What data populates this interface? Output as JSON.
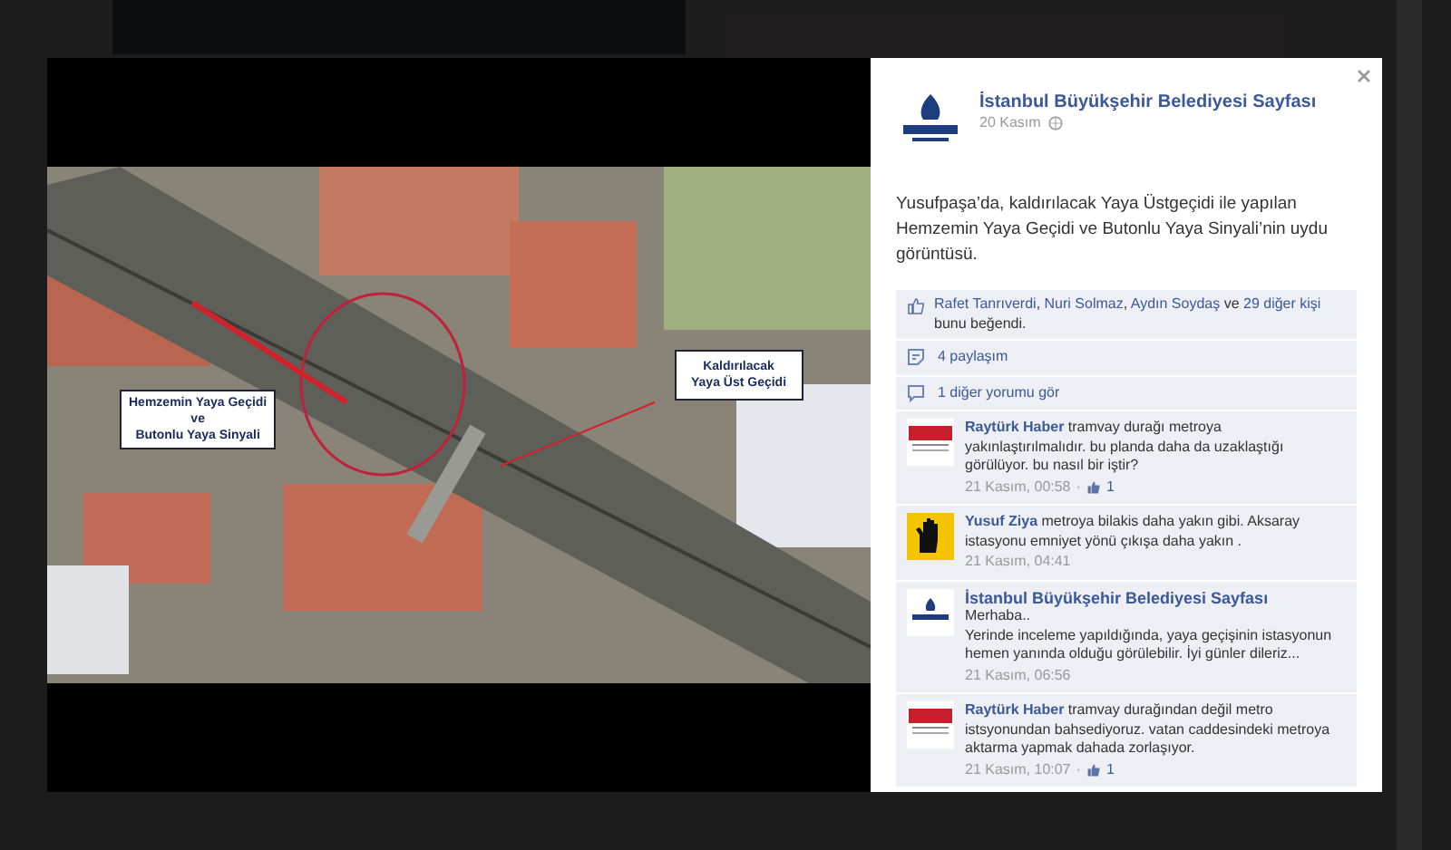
{
  "photo": {
    "labels": [
      "Hemzemin Yaya Geçidi\nve\nButonlu Yaya Sinyali",
      "Kaldırılacak\nYaya Üst Geçidi"
    ]
  },
  "post": {
    "page_name": "İstanbul Büyükşehir Belediyesi Sayfası",
    "date": "20 Kasım",
    "text": "Yusufpaşa’da, kaldırılacak Yaya Üstgeçidi ile yapılan Hemzemin Yaya Geçidi ve Butonlu Yaya Sinyali’nin uydu görüntüsü.",
    "likes": {
      "names": [
        "Rafet Tanrıverdi",
        "Nuri Solmaz",
        "Aydın Soydaş"
      ],
      "sep": ", ",
      "joiner": " ve ",
      "others": "29 diğer kişi",
      "suffix": " bunu beğendi."
    },
    "shares": "4 paylaşım",
    "more_comments": "1 diğer yorumu gör"
  },
  "comments": [
    {
      "kind": "ytu",
      "author": "Raytürk Haber",
      "text": "tramvay durağı metroya yakınlaştırılmalıdır. bu planda daha da uzaklaştığı görülüyor. bu nasıl bir iştir?",
      "time": "21 Kasım, 00:58",
      "separator": "·",
      "likes": "1"
    },
    {
      "kind": "hand",
      "author": "Yusuf Ziya",
      "text": "metroya bilakis daha yakın gibi. Aksaray istasyonu emniyet yönü çıkışa daha yakın .",
      "time": "21 Kasım, 04:41"
    },
    {
      "kind": "ibb",
      "author": "İstanbul Büyükşehir Belediyesi Sayfası",
      "text": "Merhaba..\nYerinde inceleme yapıldığında, yaya geçişinin istasyonun hemen yanında olduğu görülebilir. İyi günler dileriz...",
      "time": "21 Kasım, 06:56"
    },
    {
      "kind": "ytu",
      "author": "Raytürk Haber",
      "text": "tramvay durağından değil metro istsyonundan bahsediyoruz. vatan caddesindeki metroya aktarma yapmak dahada zorlaşıyor.",
      "time": "21 Kasım, 10:07",
      "separator": "·",
      "likes": "1"
    }
  ]
}
